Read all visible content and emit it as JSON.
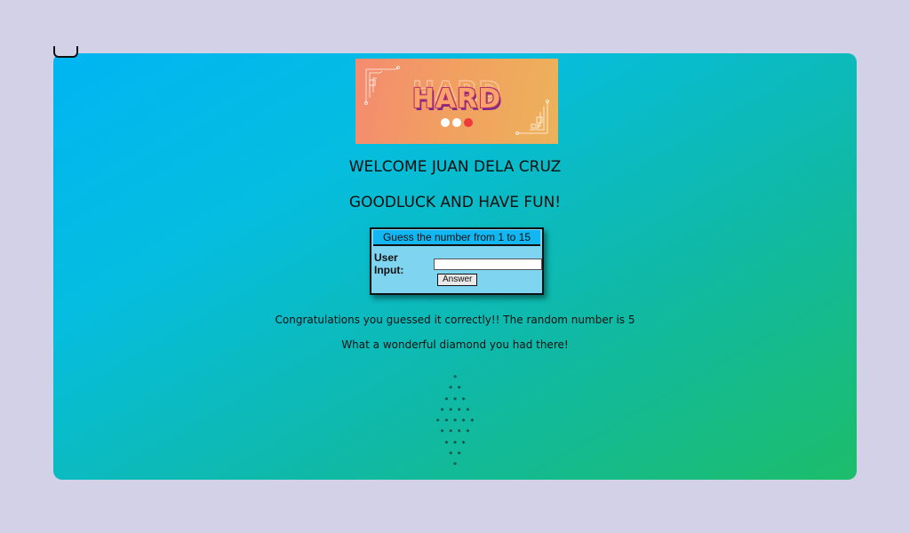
{
  "banner": {
    "word": "HARD"
  },
  "greeting": {
    "welcome": "WELCOME JUAN DELA CRUZ",
    "goodluck": "GOODLUCK AND HAVE FUN!"
  },
  "game": {
    "title": "Guess the number from 1 to 15",
    "input_label": "User Input:",
    "input_value": "",
    "answer_label": "Answer"
  },
  "result": {
    "congrats": "Congratulations you guessed it correctly!! The random number is 5",
    "diamond_message": "What a wonderful diamond you had there!"
  },
  "diamond": {
    "rows": [
      "*",
      "* *",
      "* * *",
      "* * * *",
      "* * * * *",
      "* * * *",
      "* * *",
      "* *",
      "*"
    ]
  },
  "colors": {
    "page_background": "#d3d1e8",
    "gradient_start": "#00b5f2",
    "gradient_end": "#1cbd6a",
    "panel": "#7fd4ef",
    "panel_title": "#12b6f0"
  }
}
